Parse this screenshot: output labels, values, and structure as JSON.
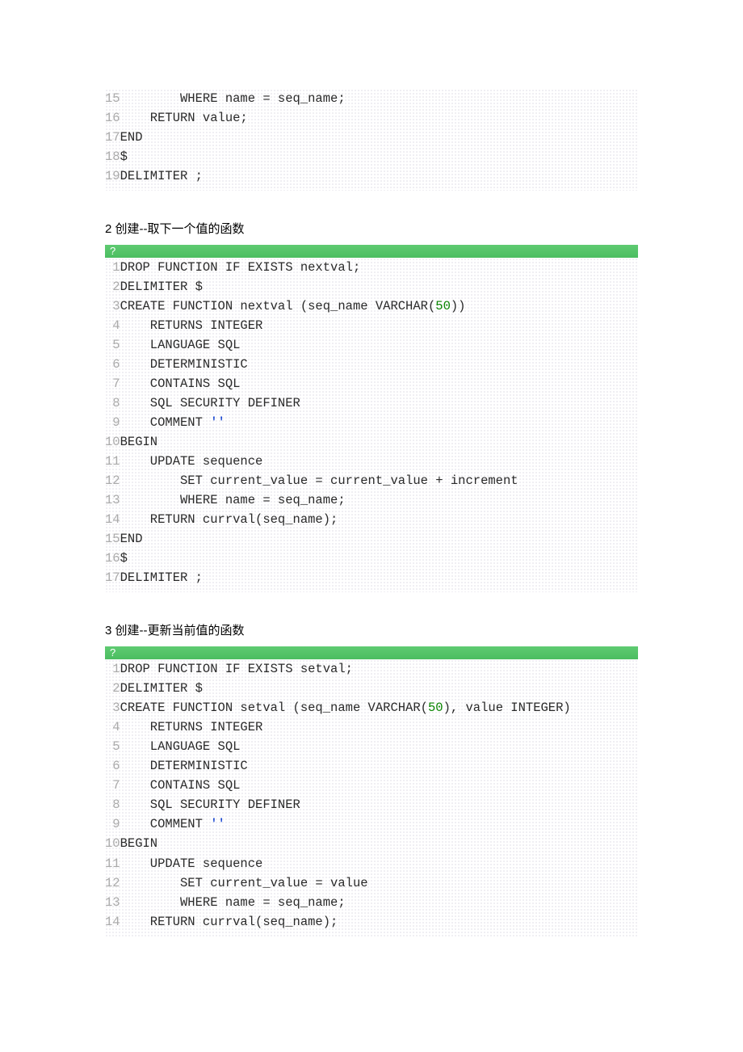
{
  "block1": {
    "lines": [
      {
        "n": "15",
        "pre": "        WHERE name = seq_name;"
      },
      {
        "n": "16",
        "pre": "    RETURN value;"
      },
      {
        "n": "17",
        "pre": "END"
      },
      {
        "n": "18",
        "pre": "$"
      },
      {
        "n": "19",
        "pre": "DELIMITER ;"
      }
    ]
  },
  "section2": {
    "title": "2 创建--取下一个值的函数",
    "bar": "?",
    "lines": [
      {
        "n": " 1",
        "pre": "DROP FUNCTION IF EXISTS nextval;"
      },
      {
        "n": " 2",
        "pre": "DELIMITER $"
      },
      {
        "n": " 3",
        "pre": "CREATE FUNCTION nextval (seq_name VARCHAR(",
        "num": "50",
        "post": "))"
      },
      {
        "n": " 4",
        "pre": "    RETURNS INTEGER"
      },
      {
        "n": " 5",
        "pre": "    LANGUAGE SQL"
      },
      {
        "n": " 6",
        "pre": "    DETERMINISTIC"
      },
      {
        "n": " 7",
        "pre": "    CONTAINS SQL"
      },
      {
        "n": " 8",
        "pre": "    SQL SECURITY DEFINER"
      },
      {
        "n": " 9",
        "pre": "    COMMENT ",
        "str": "''"
      },
      {
        "n": "10",
        "pre": "BEGIN"
      },
      {
        "n": "11",
        "pre": "    UPDATE sequence"
      },
      {
        "n": "12",
        "pre": "        SET current_value = current_value + increment"
      },
      {
        "n": "13",
        "pre": "        WHERE name = seq_name;"
      },
      {
        "n": "14",
        "pre": "    RETURN currval(seq_name);"
      },
      {
        "n": "15",
        "pre": "END"
      },
      {
        "n": "16",
        "pre": "$"
      },
      {
        "n": "17",
        "pre": "DELIMITER ;"
      }
    ]
  },
  "section3": {
    "title": "3 创建--更新当前值的函数",
    "bar": "?",
    "lines": [
      {
        "n": " 1",
        "pre": "DROP FUNCTION IF EXISTS setval;"
      },
      {
        "n": " 2",
        "pre": "DELIMITER $"
      },
      {
        "n": " 3",
        "pre": "CREATE FUNCTION setval (seq_name VARCHAR(",
        "num": "50",
        "post": "), value INTEGER)"
      },
      {
        "n": " 4",
        "pre": "    RETURNS INTEGER"
      },
      {
        "n": " 5",
        "pre": "    LANGUAGE SQL"
      },
      {
        "n": " 6",
        "pre": "    DETERMINISTIC"
      },
      {
        "n": " 7",
        "pre": "    CONTAINS SQL"
      },
      {
        "n": " 8",
        "pre": "    SQL SECURITY DEFINER"
      },
      {
        "n": " 9",
        "pre": "    COMMENT ",
        "str": "''"
      },
      {
        "n": "10",
        "pre": "BEGIN"
      },
      {
        "n": "11",
        "pre": "    UPDATE sequence"
      },
      {
        "n": "12",
        "pre": "        SET current_value = value"
      },
      {
        "n": "13",
        "pre": "        WHERE name = seq_name;"
      },
      {
        "n": "14",
        "pre": "    RETURN currval(seq_name);"
      }
    ]
  }
}
